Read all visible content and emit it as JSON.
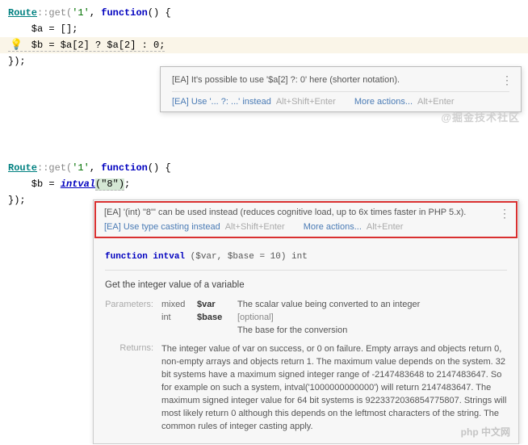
{
  "code1": {
    "line1_route": "Route",
    "line1_get": "::get(",
    "line1_str": "'1'",
    "line1_sep": ", ",
    "line1_func": "function",
    "line1_rest": "() {",
    "line2": "    $a = [];",
    "line3": "    $b = $a[2] ? $a[2] : 0;",
    "line4": "});"
  },
  "tooltip1": {
    "main": "[EA] It's possible to use '$a[2] ?: 0' here (shorter notation).",
    "action": "[EA] Use '... ?: ...' instead",
    "hint1": "Alt+Shift+Enter",
    "more": "More actions...",
    "hint2": "Alt+Enter"
  },
  "watermark1": "@掘金技术社区",
  "code2": {
    "line1_route": "Route",
    "line1_get": "::get(",
    "line1_str": "'1'",
    "line1_sep": ", ",
    "line1_func": "function",
    "line1_rest": "() {",
    "line2_pre": "    $b = ",
    "line2_intval": "intval",
    "line2_arg": "(\"8\")",
    "line2_end": ";",
    "line3": "});"
  },
  "tooltip2": {
    "main": "[EA] '(int) \"8\"' can be used instead (reduces cognitive load, up to 6x times faster in PHP 5.x).",
    "action": "[EA] Use type casting instead",
    "hint1": "Alt+Shift+Enter",
    "more": "More actions...",
    "hint2": "Alt+Enter",
    "sig_func": "function",
    "sig_name": " intval ",
    "sig_params": "($var, $base = 10)",
    "sig_ret": " int",
    "desc": "Get the integer value of a variable",
    "params_label": "Parameters:",
    "p1_type": "mixed",
    "p1_name": "$var",
    "p1_desc": "The scalar value being converted to an integer",
    "p2_type": "int",
    "p2_name": "$base",
    "p2_opt": "[optional]",
    "p2_desc": "The base for the conversion",
    "returns_label": "Returns:",
    "returns_text": "The integer value of var on success, or 0 on failure. Empty arrays and objects return 0, non-empty arrays and objects return 1.\nThe maximum value depends on the system. 32 bit systems have a maximum signed integer range of -2147483648 to 2147483647. So for example on such a system, intval('1000000000000') will return 2147483647. The maximum signed integer value for 64 bit systems is 9223372036854775807.\nStrings will most likely return 0 although this depends on the leftmost characters of the string. The common rules of integer casting apply."
  },
  "watermark2": "php 中文网"
}
